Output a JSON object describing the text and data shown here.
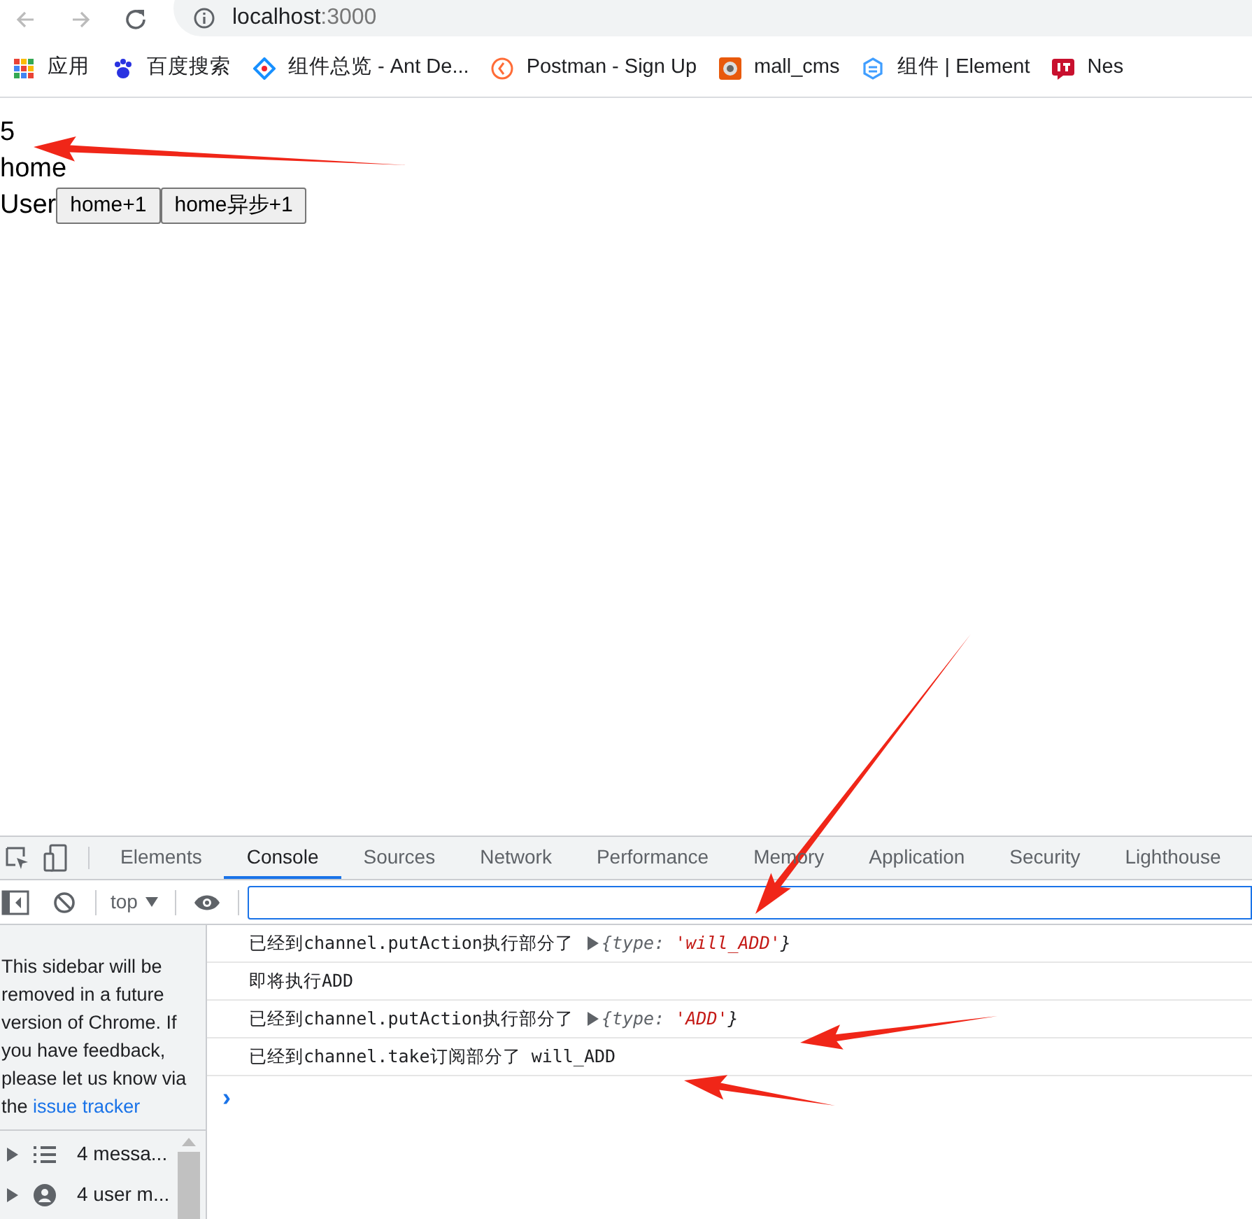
{
  "browser": {
    "url_host": "localhost",
    "url_port": ":3000",
    "bookmarks": [
      {
        "kind": "apps",
        "label": "应用"
      },
      {
        "kind": "paw",
        "label": "百度搜索"
      },
      {
        "kind": "diamond",
        "label": "组件总览 - Ant De..."
      },
      {
        "kind": "postman",
        "label": "Postman - Sign Up"
      },
      {
        "kind": "cms",
        "label": "mall_cms"
      },
      {
        "kind": "hexagon",
        "label": "组件 | Element"
      },
      {
        "kind": "it",
        "label": "Nes"
      }
    ]
  },
  "page": {
    "count": "5",
    "name": "home",
    "user_label": "User",
    "buttons": [
      "home+1",
      "home异步+1"
    ]
  },
  "devtools": {
    "tabs": [
      {
        "label": "Elements",
        "selected": false
      },
      {
        "label": "Console",
        "selected": true
      },
      {
        "label": "Sources",
        "selected": false
      },
      {
        "label": "Network",
        "selected": false
      },
      {
        "label": "Performance",
        "selected": false
      },
      {
        "label": "Memory",
        "selected": false
      },
      {
        "label": "Application",
        "selected": false
      },
      {
        "label": "Security",
        "selected": false
      },
      {
        "label": "Lighthouse",
        "selected": false
      }
    ],
    "context": "top",
    "sidebar": {
      "notice": "This sidebar will be removed in a future version of Chrome. If you have feedback, please let us know via the",
      "link": "issue tracker",
      "items": [
        {
          "kind": "list",
          "label": "4 messa..."
        },
        {
          "kind": "user",
          "label": "4 user m..."
        }
      ]
    },
    "messages": [
      {
        "text": "已经到channel.putAction执行部分了",
        "object_key": "{type:",
        "object_value": "'will_ADD'",
        "object_end": "}"
      },
      {
        "text": "即将执行ADD"
      },
      {
        "text": "已经到channel.putAction执行部分了",
        "object_key": "{type:",
        "object_value": "'ADD'",
        "object_end": "}"
      },
      {
        "text": "已经到channel.take订阅部分了 will_ADD"
      }
    ],
    "prompt": "›"
  }
}
